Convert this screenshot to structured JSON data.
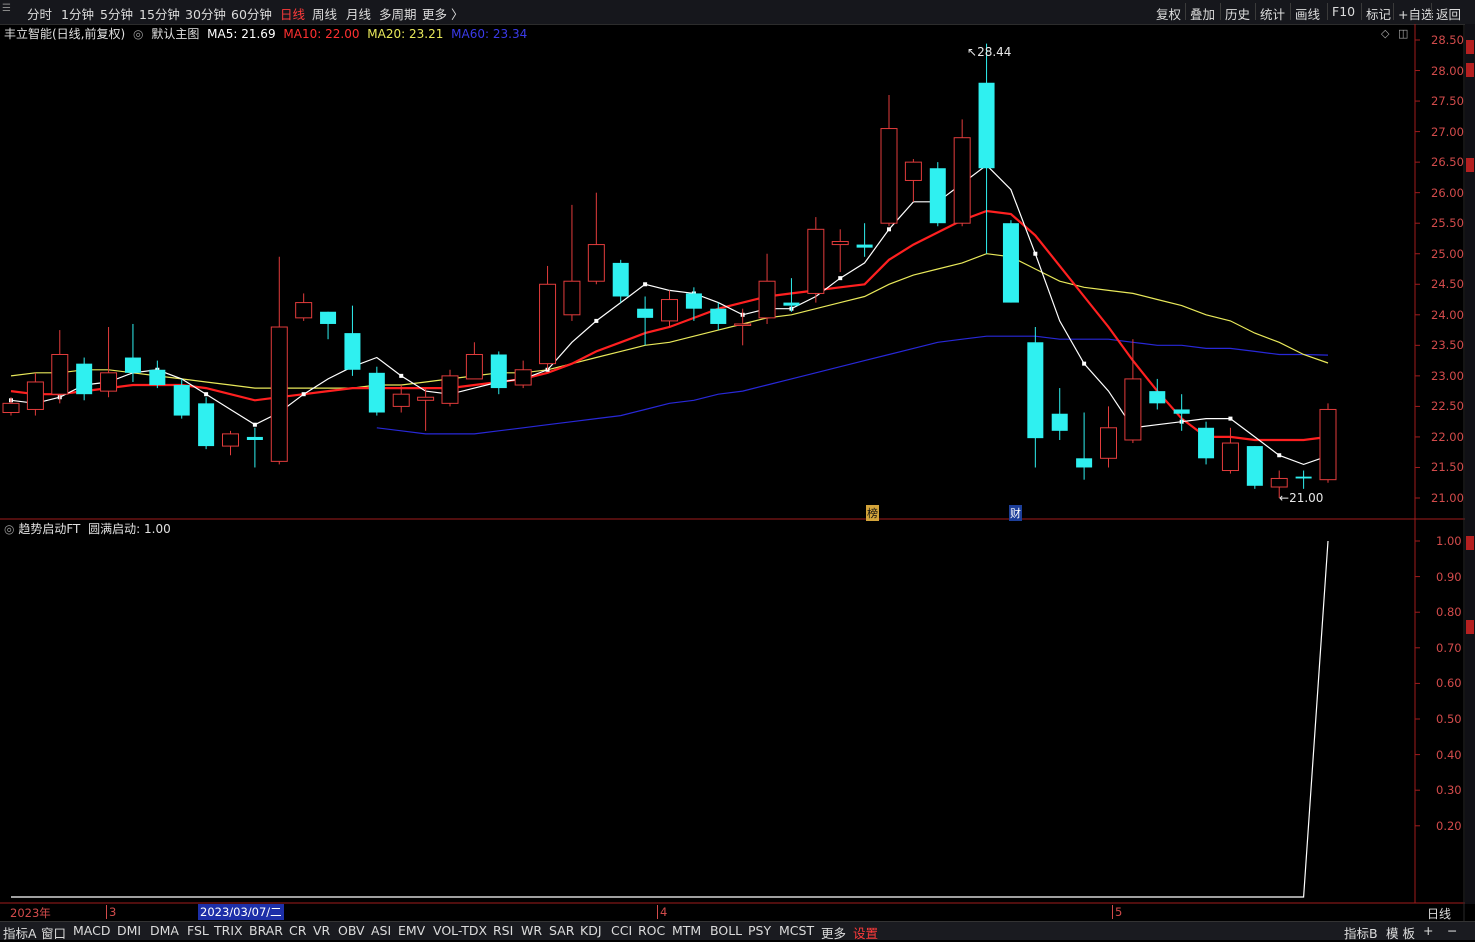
{
  "topbar": {
    "periods": [
      "分时",
      "1分钟",
      "5分钟",
      "15分钟",
      "30分钟",
      "60分钟",
      "日线",
      "周线",
      "月线",
      "多周期",
      "更多 〉"
    ],
    "active_period": "日线",
    "right_buttons": [
      "复权",
      "叠加",
      "历史",
      "统计",
      "画线",
      "F10",
      "标记",
      "+自选",
      "返回"
    ]
  },
  "stock": {
    "name": "丰立智能(日线,前复权)",
    "main_chart": "默认主图",
    "ma5": "MA5: 21.69",
    "ma10": "MA10: 22.00",
    "ma20": "MA20: 23.21",
    "ma60": "MA60: 23.34"
  },
  "colors": {
    "up": "#e23c3c",
    "down": "#2ff0f0",
    "ma5": "#ffffff",
    "ma10": "#ff2020",
    "ma20": "#e8e85a",
    "ma60": "#2828d8",
    "axis": "#d24b4b"
  },
  "price_axis": [
    "28.50",
    "28.00",
    "27.50",
    "27.00",
    "26.50",
    "26.00",
    "25.50",
    "25.00",
    "24.50",
    "24.00",
    "23.50",
    "23.00",
    "22.50",
    "22.00",
    "21.50",
    "21.00"
  ],
  "annotations": {
    "high": "28.44",
    "low": "21.00",
    "flag1": "榜",
    "flag2": "财"
  },
  "indicator": {
    "name": "趋势启动FT",
    "value": "圆满启动: 1.00"
  },
  "indicator_axis": [
    "1.00",
    "0.90",
    "0.80",
    "0.70",
    "0.60",
    "0.50",
    "0.40",
    "0.30",
    "0.20"
  ],
  "date_axis": {
    "year": "2023年",
    "m3": "3",
    "cursor_date": "2023/03/07/二",
    "m4": "4",
    "m5": "5",
    "period": "日线"
  },
  "bottombar": {
    "tabs": [
      "指标A",
      "窗口",
      "MACD",
      "DMI",
      "DMA",
      "FSL",
      "TRIX",
      "BRAR",
      "CR",
      "VR",
      "OBV",
      "ASI",
      "EMV",
      "VOL-TDX",
      "RSI",
      "WR",
      "SAR",
      "KDJ",
      "CCI",
      "ROC",
      "MTM",
      "BOLL",
      "PSY",
      "MCST",
      "更多",
      "设置"
    ],
    "right": [
      "指标B",
      "模 板",
      "+",
      "−"
    ]
  },
  "chart_data": {
    "type": "candlestick",
    "ylim": [
      20.8,
      28.6
    ],
    "candles": [
      {
        "o": 22.4,
        "c": 22.55,
        "h": 22.65,
        "l": 22.35
      },
      {
        "o": 22.45,
        "c": 22.9,
        "h": 23.05,
        "l": 22.35
      },
      {
        "o": 22.7,
        "c": 23.35,
        "h": 23.75,
        "l": 22.55
      },
      {
        "o": 23.2,
        "c": 22.7,
        "h": 23.3,
        "l": 22.6
      },
      {
        "o": 22.75,
        "c": 23.05,
        "h": 23.8,
        "l": 22.65
      },
      {
        "o": 23.3,
        "c": 23.05,
        "h": 23.85,
        "l": 22.9
      },
      {
        "o": 23.1,
        "c": 22.85,
        "h": 23.25,
        "l": 22.8
      },
      {
        "o": 22.85,
        "c": 22.35,
        "h": 22.95,
        "l": 22.3
      },
      {
        "o": 22.55,
        "c": 21.85,
        "h": 22.65,
        "l": 21.8
      },
      {
        "o": 21.85,
        "c": 22.05,
        "h": 22.1,
        "l": 21.7
      },
      {
        "o": 22.0,
        "c": 21.95,
        "h": 22.15,
        "l": 21.5
      },
      {
        "o": 21.6,
        "c": 23.8,
        "h": 24.95,
        "l": 21.55
      },
      {
        "o": 23.95,
        "c": 24.2,
        "h": 24.35,
        "l": 23.9
      },
      {
        "o": 24.05,
        "c": 23.85,
        "h": 24.05,
        "l": 23.6
      },
      {
        "o": 23.7,
        "c": 23.1,
        "h": 24.15,
        "l": 23.0
      },
      {
        "o": 23.05,
        "c": 22.4,
        "h": 23.15,
        "l": 22.35
      },
      {
        "o": 22.5,
        "c": 22.7,
        "h": 22.85,
        "l": 22.4
      },
      {
        "o": 22.6,
        "c": 22.65,
        "h": 22.8,
        "l": 22.1
      },
      {
        "o": 22.55,
        "c": 23.0,
        "h": 23.1,
        "l": 22.5
      },
      {
        "o": 22.95,
        "c": 23.35,
        "h": 23.55,
        "l": 22.95
      },
      {
        "o": 23.35,
        "c": 22.8,
        "h": 23.4,
        "l": 22.7
      },
      {
        "o": 22.85,
        "c": 23.1,
        "h": 23.25,
        "l": 22.8
      },
      {
        "o": 23.2,
        "c": 24.5,
        "h": 24.8,
        "l": 23.1
      },
      {
        "o": 24.0,
        "c": 24.55,
        "h": 25.8,
        "l": 23.9
      },
      {
        "o": 24.55,
        "c": 25.15,
        "h": 26.0,
        "l": 24.5
      },
      {
        "o": 24.85,
        "c": 24.3,
        "h": 24.9,
        "l": 24.2
      },
      {
        "o": 24.1,
        "c": 23.95,
        "h": 24.3,
        "l": 23.5
      },
      {
        "o": 23.9,
        "c": 24.25,
        "h": 24.4,
        "l": 23.8
      },
      {
        "o": 24.35,
        "c": 24.1,
        "h": 24.45,
        "l": 23.9
      },
      {
        "o": 24.1,
        "c": 23.85,
        "h": 24.2,
        "l": 23.75
      },
      {
        "o": 23.85,
        "c": 23.85,
        "h": 24.1,
        "l": 23.5
      },
      {
        "o": 23.95,
        "c": 24.55,
        "h": 25.0,
        "l": 23.85
      },
      {
        "o": 24.2,
        "c": 24.15,
        "h": 24.6,
        "l": 24.05
      },
      {
        "o": 24.35,
        "c": 25.4,
        "h": 25.6,
        "l": 24.2
      },
      {
        "o": 25.15,
        "c": 25.2,
        "h": 25.4,
        "l": 24.7
      },
      {
        "o": 25.15,
        "c": 25.1,
        "h": 25.5,
        "l": 24.95
      },
      {
        "o": 25.5,
        "c": 27.05,
        "h": 27.6,
        "l": 25.45
      },
      {
        "o": 26.2,
        "c": 26.5,
        "h": 26.55,
        "l": 25.85
      },
      {
        "o": 26.4,
        "c": 25.5,
        "h": 26.5,
        "l": 25.45
      },
      {
        "o": 25.5,
        "c": 26.9,
        "h": 27.2,
        "l": 25.45
      },
      {
        "o": 27.8,
        "c": 26.4,
        "h": 28.44,
        "l": 25.0
      },
      {
        "o": 25.5,
        "c": 24.2,
        "h": 25.55,
        "l": 24.2
      },
      {
        "o": 23.55,
        "c": 21.98,
        "h": 23.8,
        "l": 21.5
      },
      {
        "o": 22.38,
        "c": 22.1,
        "h": 22.8,
        "l": 21.95
      },
      {
        "o": 21.65,
        "c": 21.5,
        "h": 22.4,
        "l": 21.3
      },
      {
        "o": 21.65,
        "c": 22.15,
        "h": 22.5,
        "l": 21.5
      },
      {
        "o": 21.95,
        "c": 22.95,
        "h": 23.6,
        "l": 21.9
      },
      {
        "o": 22.75,
        "c": 22.55,
        "h": 22.95,
        "l": 22.45
      },
      {
        "o": 22.45,
        "c": 22.38,
        "h": 22.7,
        "l": 22.1
      },
      {
        "o": 22.15,
        "c": 21.65,
        "h": 22.25,
        "l": 21.55
      },
      {
        "o": 21.45,
        "c": 21.9,
        "h": 22.15,
        "l": 21.4
      },
      {
        "o": 21.85,
        "c": 21.2,
        "h": 21.85,
        "l": 21.15
      },
      {
        "o": 21.18,
        "c": 21.32,
        "h": 21.45,
        "l": 21.0
      },
      {
        "o": 21.35,
        "c": 21.32,
        "h": 21.45,
        "l": 21.15
      },
      {
        "o": 21.3,
        "c": 22.45,
        "h": 22.55,
        "l": 21.25
      }
    ],
    "ma5": [
      22.6,
      22.55,
      22.65,
      22.85,
      22.9,
      23.05,
      23.1,
      22.95,
      22.7,
      22.45,
      22.2,
      22.4,
      22.7,
      22.95,
      23.15,
      23.3,
      23.0,
      22.75,
      22.7,
      22.8,
      22.9,
      22.95,
      23.1,
      23.55,
      23.9,
      24.2,
      24.5,
      24.4,
      24.35,
      24.2,
      24.0,
      24.1,
      24.1,
      24.3,
      24.6,
      24.85,
      25.4,
      25.85,
      25.85,
      26.15,
      26.45,
      26.05,
      25.0,
      23.9,
      23.2,
      22.75,
      22.15,
      22.2,
      22.25,
      22.3,
      22.3,
      22.0,
      21.7,
      21.55,
      21.69
    ],
    "ma10": [
      22.75,
      22.7,
      22.7,
      22.75,
      22.8,
      22.85,
      22.85,
      22.85,
      22.8,
      22.7,
      22.6,
      22.65,
      22.7,
      22.75,
      22.8,
      22.8,
      22.8,
      22.8,
      22.8,
      22.85,
      22.9,
      22.95,
      23.05,
      23.2,
      23.4,
      23.55,
      23.7,
      23.8,
      23.95,
      24.1,
      24.2,
      24.3,
      24.35,
      24.4,
      24.45,
      24.5,
      24.9,
      25.15,
      25.35,
      25.55,
      25.7,
      25.65,
      25.3,
      24.8,
      24.3,
      23.8,
      23.25,
      22.75,
      22.3,
      22.0,
      22.0,
      21.95,
      21.95,
      21.95,
      22.0
    ],
    "ma20": [
      23.0,
      23.05,
      23.05,
      23.1,
      23.1,
      23.05,
      23.0,
      22.95,
      22.9,
      22.85,
      22.8,
      22.8,
      22.8,
      22.8,
      22.8,
      22.85,
      22.85,
      22.9,
      22.95,
      23.0,
      23.05,
      23.05,
      23.1,
      23.2,
      23.3,
      23.4,
      23.5,
      23.55,
      23.65,
      23.75,
      23.85,
      23.95,
      24.0,
      24.1,
      24.2,
      24.3,
      24.5,
      24.65,
      24.75,
      24.85,
      25.0,
      24.95,
      24.75,
      24.55,
      24.45,
      24.4,
      24.35,
      24.25,
      24.15,
      24.0,
      23.9,
      23.7,
      23.55,
      23.35,
      23.21
    ],
    "ma60": [
      null,
      null,
      null,
      null,
      null,
      null,
      null,
      null,
      null,
      null,
      null,
      null,
      null,
      null,
      null,
      22.15,
      22.1,
      22.05,
      22.05,
      22.05,
      22.1,
      22.15,
      22.2,
      22.25,
      22.3,
      22.35,
      22.45,
      22.55,
      22.6,
      22.7,
      22.75,
      22.85,
      22.95,
      23.05,
      23.15,
      23.25,
      23.35,
      23.45,
      23.55,
      23.6,
      23.65,
      23.65,
      23.65,
      23.6,
      23.6,
      23.6,
      23.55,
      23.5,
      23.5,
      23.45,
      23.45,
      23.4,
      23.35,
      23.35,
      23.34
    ],
    "indicator_values": [
      0,
      0,
      0,
      0,
      0,
      0,
      0,
      0,
      0,
      0,
      0,
      0,
      0,
      0,
      0,
      0,
      0,
      0,
      0,
      0,
      0,
      0,
      0,
      0,
      0,
      0,
      0,
      0,
      0,
      0,
      0,
      0,
      0,
      0,
      0,
      0,
      0,
      0,
      0,
      0,
      0,
      0,
      0,
      0,
      0,
      0,
      0,
      0,
      0,
      0,
      0,
      0,
      0,
      0,
      1.0
    ],
    "indicator_ylim": [
      0,
      1.0
    ]
  }
}
